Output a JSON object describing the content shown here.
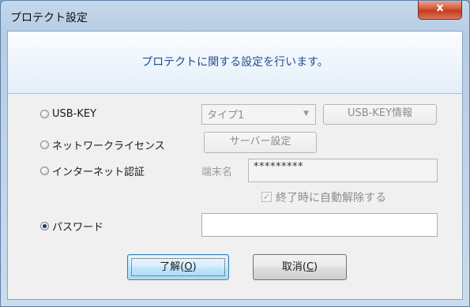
{
  "window": {
    "title": "プロテクト設定",
    "close_glyph": "x"
  },
  "header": {
    "message": "プロテクトに関する設定を行います。"
  },
  "options": {
    "usb_key": {
      "label": "USB-KEY",
      "selected": false
    },
    "network_license": {
      "label": "ネットワークライセンス",
      "selected": false
    },
    "internet_auth": {
      "label": "インターネット認証",
      "selected": false
    },
    "password": {
      "label": "パスワード",
      "selected": true
    }
  },
  "usb": {
    "type_value": "タイプ1",
    "info_button": "USB-KEY情報"
  },
  "network": {
    "server_button": "サーバー設定"
  },
  "internet": {
    "terminal_label": "端末名",
    "terminal_value": "*********",
    "auto_release_label": "終了時に自動解除する",
    "auto_release_checked": true
  },
  "password_field": {
    "value": ""
  },
  "buttons": {
    "ok_text": "了解(",
    "ok_key": "O",
    "ok_close": ")",
    "cancel_text": "取消(",
    "cancel_key": "C",
    "cancel_close": ")"
  },
  "colors": {
    "accent_text": "#1f4f8f",
    "close_red": "#c53a1c"
  }
}
